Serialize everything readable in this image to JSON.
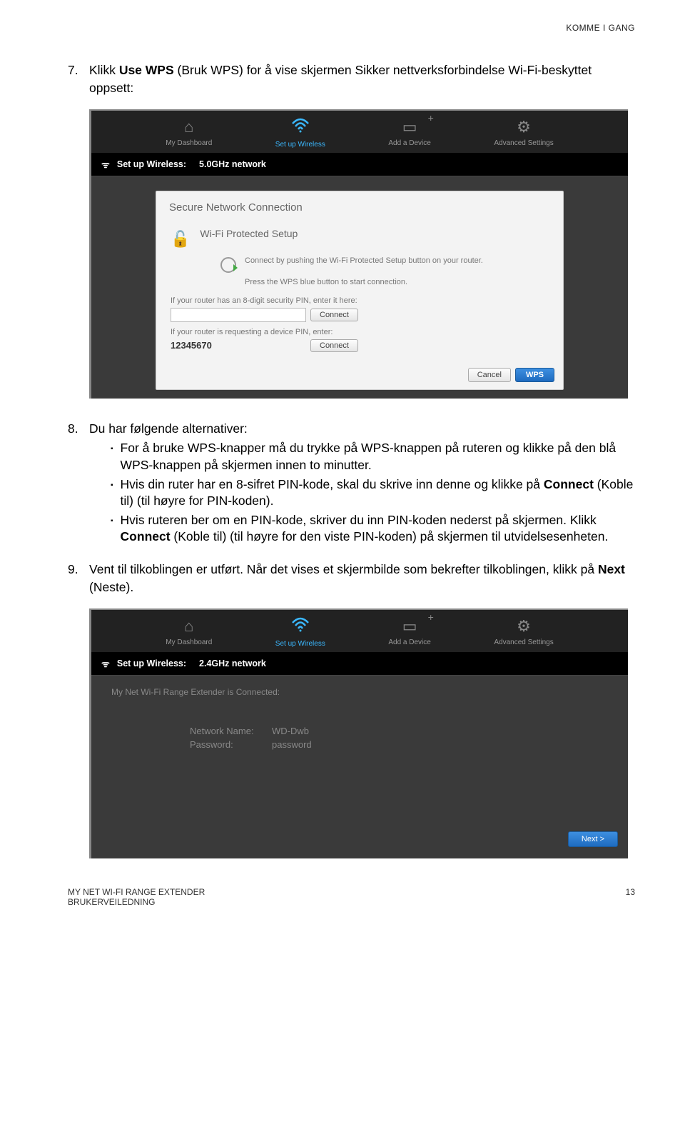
{
  "header": {
    "section": "KOMME I GANG"
  },
  "step7": {
    "num": "7.",
    "pre": "Klikk ",
    "bold": "Use WPS",
    "post": " (Bruk WPS) for å vise skjermen Sikker nettverksforbindelse Wi-Fi-beskyttet oppsett:"
  },
  "shot1": {
    "nav": {
      "dashboard": "My Dashboard",
      "wireless": "Set up Wireless",
      "device": "Add a Device",
      "advanced": "Advanced Settings"
    },
    "subhead": {
      "label": "Set up Wireless:",
      "net": "5.0GHz network"
    },
    "card": {
      "title": "Secure Network Connection",
      "wps_title": "Wi-Fi Protected Setup",
      "connect_push": "Connect by pushing the Wi-Fi Protected Setup button on your router.",
      "press_blue": "Press the WPS blue button to start connection.",
      "pin_prompt1": "If your router has an 8-digit security PIN, enter it here:",
      "connect_btn": "Connect",
      "pin_prompt2": "If your router is requesting a device PIN, enter:",
      "device_pin": "12345670",
      "cancel": "Cancel",
      "wps": "WPS"
    }
  },
  "step8": {
    "num": "8.",
    "intro": "Du har følgende alternativer:",
    "b1": "For å bruke WPS-knapper må du trykke på WPS-knappen på ruteren og klikke på den blå WPS-knappen på skjermen innen to minutter.",
    "b2_pre": "Hvis din ruter har en 8-sifret PIN-kode, skal du skrive inn denne og klikke på ",
    "b2_bold": "Connect",
    "b2_post": " (Koble til) (til høyre for PIN-koden).",
    "b3_pre": "Hvis ruteren ber om en PIN-kode, skriver du inn PIN-koden nederst på skjermen. Klikk ",
    "b3_bold": "Connect",
    "b3_post": " (Koble til) (til høyre for den viste PIN-koden) på skjermen til utvidelsesenheten."
  },
  "step9": {
    "num": "9.",
    "pre": "Vent til tilkoblingen er utført. Når det vises et skjermbilde som bekrefter tilkoblingen, klikk på ",
    "bold": "Next",
    "post": " (Neste)."
  },
  "shot2": {
    "subhead": {
      "label": "Set up Wireless:",
      "net": "2.4GHz network"
    },
    "connected": "My Net Wi-Fi Range Extender is Connected:",
    "name_label": "Network Name:",
    "name_val": "WD-Dwb",
    "pass_label": "Password:",
    "pass_val": "password",
    "next": "Next >"
  },
  "footer": {
    "left1": "MY NET WI-FI RANGE EXTENDER",
    "left2": "BRUKERVEILEDNING",
    "right": "13"
  }
}
